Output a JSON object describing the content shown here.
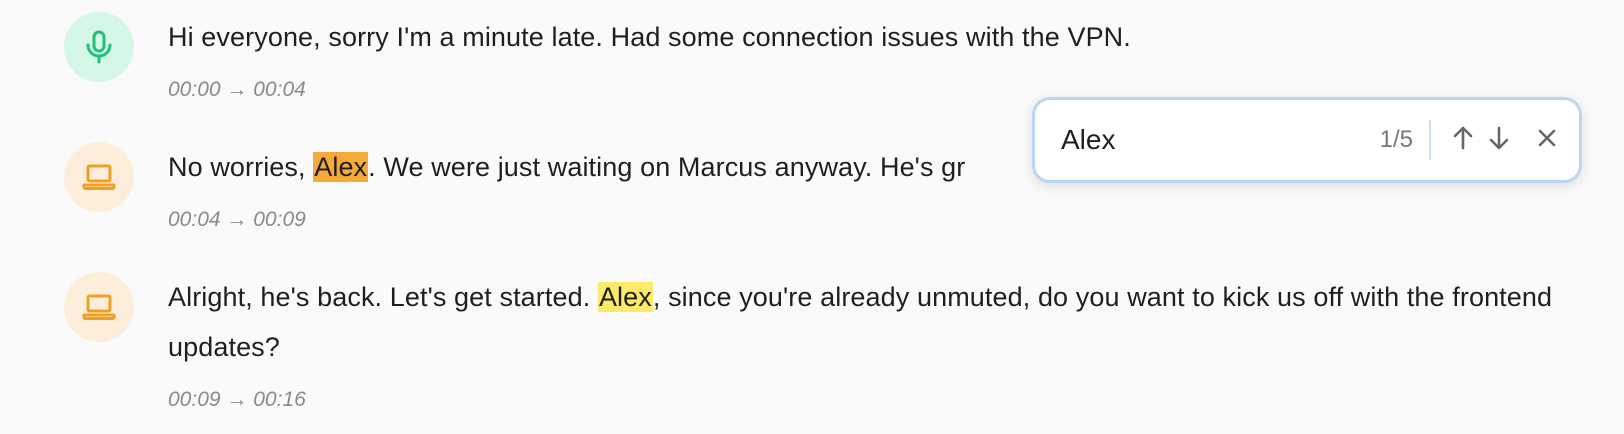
{
  "colors": {
    "mic_avatar_bg": "#d4f7e6",
    "mic_icon": "#22c07a",
    "laptop_avatar_bg": "#fdeedb",
    "laptop_icon": "#f0a021",
    "current_match_highlight": "#f5a93a",
    "match_highlight": "#fde96a",
    "find_bar_border": "#b9d7f5"
  },
  "transcript": [
    {
      "speaker_icon": "microphone-icon",
      "text": "Hi everyone, sorry I'm a minute late. Had some connection issues with the VPN.",
      "start": "00:00",
      "arrow": "→",
      "end": "00:04"
    },
    {
      "speaker_icon": "laptop-icon",
      "text_before": "No worries, ",
      "match": "Alex",
      "text_after": ". We were just waiting on Marcus anyway. He's gr",
      "start": "00:04",
      "arrow": "→",
      "end": "00:09"
    },
    {
      "speaker_icon": "laptop-icon",
      "text_before": "Alright, he's back. Let's get started. ",
      "match": "Alex",
      "text_after": ", since you're already unmuted, do you want to kick us off with the frontend updates?",
      "start": "00:09",
      "arrow": "→",
      "end": "00:16"
    }
  ],
  "find": {
    "query": "Alex",
    "count": "1/5",
    "prev_icon": "arrow-up-icon",
    "next_icon": "arrow-down-icon",
    "close_icon": "close-icon"
  }
}
